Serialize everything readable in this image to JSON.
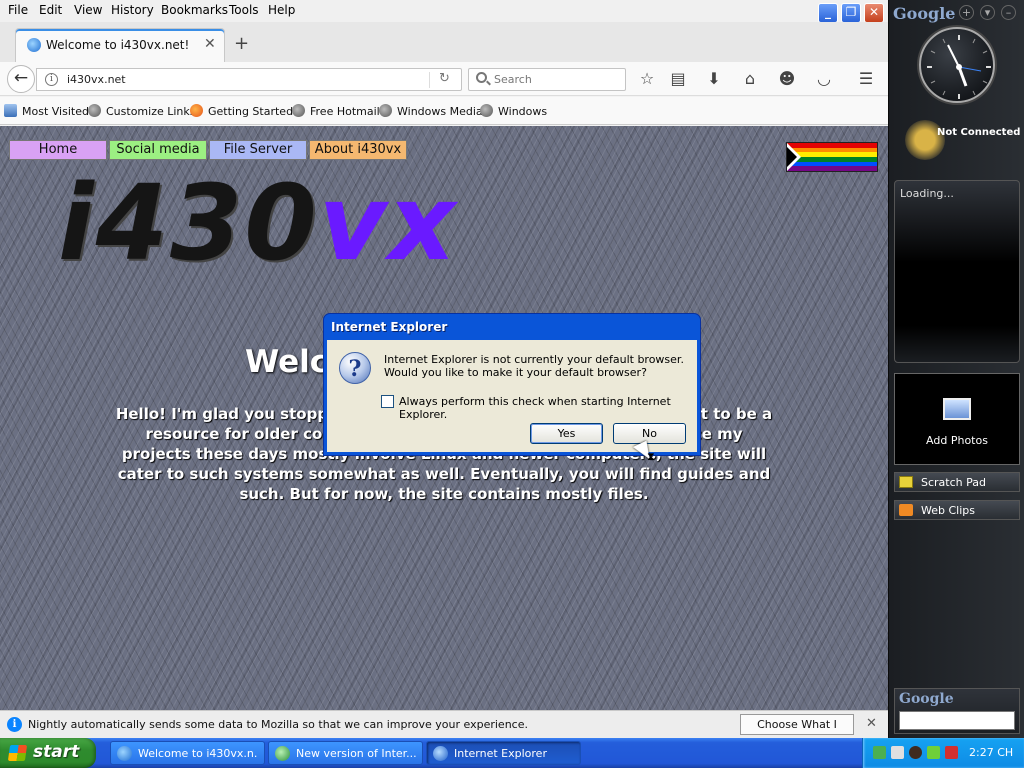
{
  "browser": {
    "menu": [
      "File",
      "Edit",
      "View",
      "History",
      "Bookmarks",
      "Tools",
      "Help"
    ],
    "tab_title": "Welcome to i430vx.net!",
    "url": "i430vx.net",
    "search_placeholder": "Search",
    "bookmarks": [
      "Most Visited",
      "Customize Links",
      "Getting Started",
      "Free Hotmail",
      "Windows Media",
      "Windows"
    ],
    "notification": {
      "text": "Nightly automatically sends some data to Mozilla so that we can improve your experience.",
      "button": "Choose What I Share"
    }
  },
  "page": {
    "nav": [
      "Home",
      "Social media",
      "File Server",
      "About i430vx"
    ],
    "nav_colors": [
      "#d9a2f5",
      "#9cf082",
      "#aab8f5",
      "#f5b870"
    ],
    "logo_part1": "i430",
    "logo_part2": "vx",
    "welcome_title": "Welcome",
    "welcome_body": "Hello! I'm glad you stopped by. This site is (and always will be) meant to be a resource for older computers, mostly from the 90s. However, since my projects these days mostly involve Linux and newer computers, the site will cater to such systems somewhat as well. Eventually, you will find guides and such. But for now, the site contains mostly files."
  },
  "dialog": {
    "title": "Internet Explorer",
    "message": "Internet Explorer is not currently your default browser. Would you like to make it your default browser?",
    "checkbox_label": "Always perform this check when starting Internet Explorer.",
    "checkbox_checked": false,
    "yes_label": "Yes",
    "no_label": "No"
  },
  "sidebar": {
    "logo": "Google",
    "weather": "Not Connected",
    "loading": "Loading...",
    "photos": "Add Photos",
    "scratch_pad": "Scratch Pad",
    "web_clips": "Web Clips",
    "search_logo": "Google"
  },
  "taskbar": {
    "start": "start",
    "tasks": [
      "Welcome to i430vx.n...",
      "New version of Inter...",
      "Internet Explorer"
    ],
    "time": "2:27 CH"
  },
  "icons": {
    "tab": "firefox-icon",
    "dialog": "question-icon",
    "start": "windows-flag-icon"
  }
}
